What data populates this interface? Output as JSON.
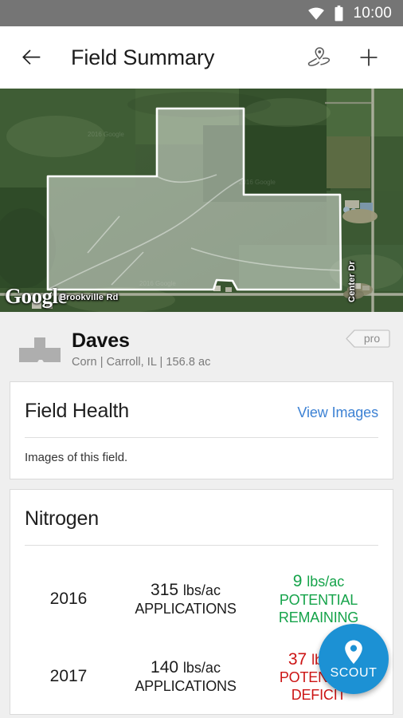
{
  "status_bar": {
    "time": "10:00",
    "wifi_icon": "wifi-icon",
    "battery_icon": "battery-icon"
  },
  "app_bar": {
    "back_icon": "back-arrow-icon",
    "title": "Field Summary",
    "scout_icon": "scout-map-pin-icon",
    "add_icon": "plus-icon"
  },
  "map": {
    "watermark": "Google",
    "road_labels": [
      "Brookville Rd",
      "Center Dr"
    ],
    "boundary_stroke": "#ffffff",
    "boundary_fill": "rgba(255,255,255,0.45)"
  },
  "field": {
    "shape_icon": "field-shape-icon",
    "name": "Daves",
    "subtitle": "Corn | Carroll, IL | 156.8 ac",
    "badge": "pro"
  },
  "cards": {
    "field_health": {
      "title": "Field Health",
      "action": "View Images",
      "body": "Images of this field."
    },
    "nitrogen": {
      "title": "Nitrogen",
      "rows": [
        {
          "year": "2016",
          "amount": "315",
          "unit": "lbs/ac",
          "label": "APPLICATIONS",
          "status_amount": "9",
          "status_unit": "lbs/ac",
          "status_label": "POTENTIAL REMAINING",
          "status_type": "positive",
          "status_color": "#15a34a"
        },
        {
          "year": "2017",
          "amount": "140",
          "unit": "lbs/ac",
          "label": "APPLICATIONS",
          "status_amount": "37",
          "status_unit": "lbs/ac",
          "status_label": "POTENTIAL DEFICIT",
          "status_type": "negative",
          "status_color": "#cc1414"
        }
      ]
    }
  },
  "fab": {
    "label": "SCOUT",
    "icon": "map-pin-icon",
    "color": "#1c91d4"
  }
}
